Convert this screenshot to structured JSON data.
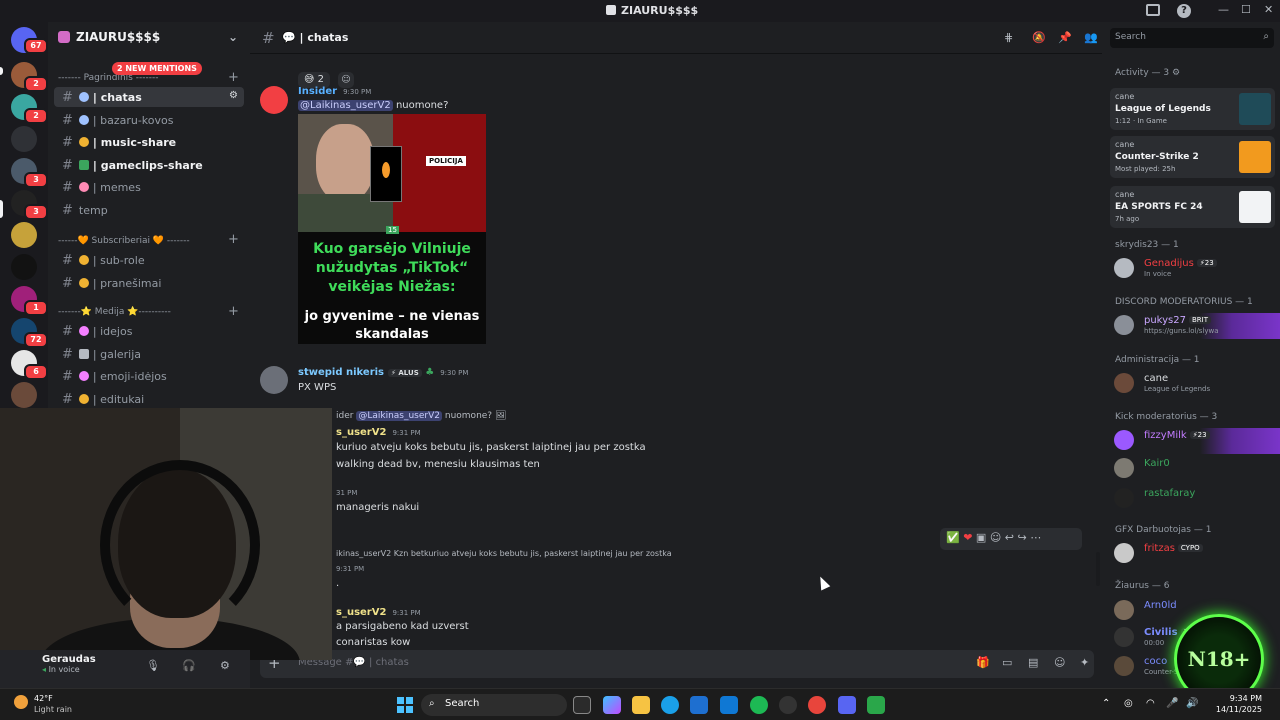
{
  "window": {
    "title": "ZIAURU$$$$"
  },
  "rail": {
    "badges": [
      "67",
      "2",
      "2",
      "3",
      "3",
      "1",
      "2",
      "2",
      "1",
      "72",
      "6"
    ]
  },
  "server": {
    "name": "ZIAURU$$$$",
    "new_mentions": "2 NEW MENTIONS"
  },
  "categories": {
    "c1": "------- Pagrindinis -------",
    "c2": "------🧡 Subscriberiai 🧡 -------",
    "c3": "-------⭐ Medija ⭐----------"
  },
  "channels": [
    {
      "label": "| chatas"
    },
    {
      "label": "| bazaru-kovos"
    },
    {
      "label": "| music-share"
    },
    {
      "label": "| gameclips-share"
    },
    {
      "label": "| memes"
    },
    {
      "label": "temp"
    },
    {
      "label": "| sub-role"
    },
    {
      "label": "| pranešimai"
    },
    {
      "label": "| idejos"
    },
    {
      "label": "| galerija"
    },
    {
      "label": "| emoji-idėjos"
    },
    {
      "label": "| editukai"
    }
  ],
  "user": {
    "name": "Geraudas",
    "status": "In voice"
  },
  "chat": {
    "channel": "chatas",
    "reaction_count": "2",
    "messages": [
      {
        "author": "Insider",
        "time": "9:30 PM",
        "mention": "@Laikinas_userV2",
        "text": "nuomone?"
      },
      {
        "author": "stwepid nikeris",
        "tag": "ALUS",
        "time": "9:30 PM",
        "text": "PX WPS"
      }
    ],
    "news": {
      "num": "15",
      "police": "POLICIJA",
      "headline": "Kuo garsėjo Vilniuje nužudytas „TikTok“ veikėjas Niežas:",
      "sub": "jo gyvenime – ne vienas skandalas"
    },
    "reply1": {
      "prefix": "ider",
      "mention": "@Laikinas_userV2",
      "text": "nuomone?"
    },
    "msg3": {
      "author": "s_userV2",
      "time": "9:31 PM",
      "line1": "kuriuo atveju koks bebutu jis, paskerst laiptinej jau per zostka",
      "line2": "walking dead bv, menesiu klausimas ten"
    },
    "msg4": {
      "time": "31 PM",
      "text": "manageris nakui"
    },
    "reply2": {
      "text": "ikinas_userV2 Kzn betkuriuo atveju koks bebutu jis, paskerst laiptinej jau per zostka"
    },
    "msg5": {
      "time": "9:31 PM",
      "text": "."
    },
    "msg6": {
      "author": "s_userV2",
      "time": "9:31 PM",
      "line1": "a parsigabeno kad uzverst",
      "line2": "conaristas kow"
    },
    "composer_placeholder": "Message #💬 | chatas"
  },
  "members": {
    "search_placeholder": "Search",
    "activity_header": "Activity — 3",
    "activities": [
      {
        "who": "cane",
        "game": "League of Legends",
        "sub": "1:12 · In Game"
      },
      {
        "who": "cane",
        "game": "Counter-Strike 2",
        "sub": "Most played: 25h"
      },
      {
        "who": "cane",
        "game": "EA SPORTS FC 24",
        "sub": "7h ago"
      }
    ],
    "groups": [
      {
        "header": "skrydis23 — 1",
        "members": [
          {
            "name": "Genadijus",
            "badge": "⚡23",
            "status": "In voice",
            "color": "#f23f43"
          }
        ]
      },
      {
        "header": "DISCORD MODERATORIUS — 1",
        "members": [
          {
            "name": "pukys27",
            "badge": "BRIT",
            "status": "https://guns.lol/slywa",
            "color": "#c9a7ff"
          }
        ]
      },
      {
        "header": "Administracija — 1",
        "members": [
          {
            "name": "cane",
            "badge": "",
            "status": "League of Legends",
            "color": "#dbdee1"
          }
        ]
      },
      {
        "header": "Kick moderatorius — 3",
        "members": [
          {
            "name": "fizzyMilk",
            "badge": "⚡23",
            "status": "",
            "color": "#c27cff"
          },
          {
            "name": "Kair0",
            "badge": "",
            "status": "",
            "color": "#3ba55d"
          },
          {
            "name": "rastafaray",
            "badge": "",
            "status": "",
            "color": "#3ba55d"
          }
        ]
      },
      {
        "header": "GFX Darbuotojas — 1",
        "members": [
          {
            "name": "fritzas",
            "badge": "CYPO",
            "status": "",
            "color": "#f23f43"
          }
        ]
      },
      {
        "header": "Žiaurus — 6",
        "members": [
          {
            "name": "Arn0ld",
            "badge": "",
            "status": "",
            "color": "#7b8cff"
          },
          {
            "name": "Civilis",
            "badge": "120kg",
            "status": "00:00",
            "color": "#7b8cff"
          },
          {
            "name": "coco",
            "badge": "",
            "status": "Counter-Strike 2",
            "color": "#7b8cff"
          }
        ]
      }
    ]
  },
  "overlay": {
    "n18": "N18+"
  },
  "taskbar": {
    "temp": "42°F",
    "cond": "Light rain",
    "search": "Search",
    "time": "9:34 PM",
    "date": "14/11/2025"
  }
}
